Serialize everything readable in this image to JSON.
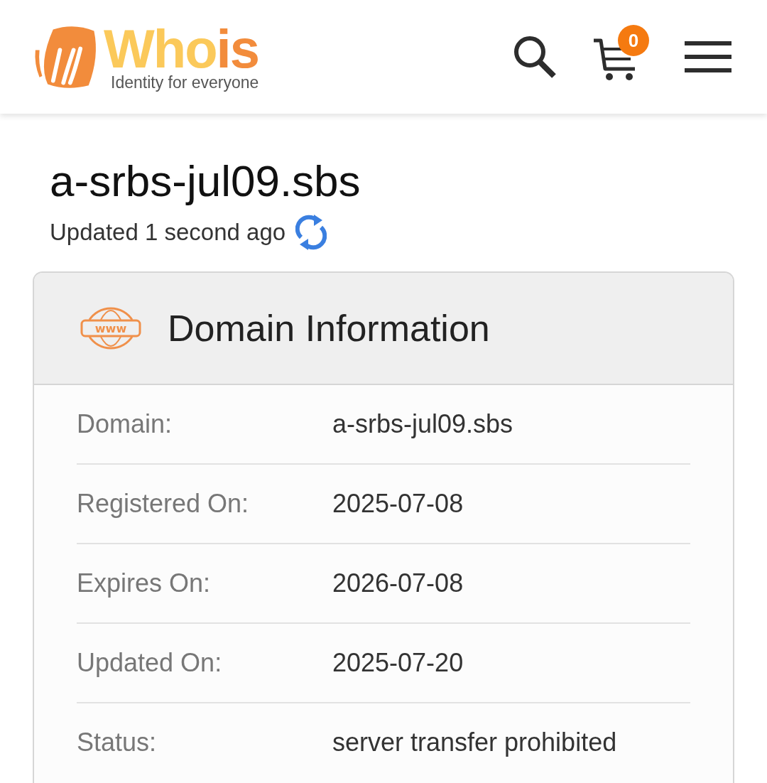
{
  "header": {
    "logo": {
      "word_first": "Who",
      "word_second": "is",
      "tagline": "Identity for everyone"
    },
    "cart_count": "0"
  },
  "domain_title": "a-srbs-jul09.sbs",
  "updated_text": "Updated 1 second ago",
  "card": {
    "title": "Domain Information",
    "icon_text": "www",
    "rows": [
      {
        "label": "Domain:",
        "value": "a-srbs-jul09.sbs"
      },
      {
        "label": "Registered On:",
        "value": "2025-07-08"
      },
      {
        "label": "Expires On:",
        "value": "2026-07-08"
      },
      {
        "label": "Updated On:",
        "value": "2025-07-20"
      },
      {
        "label": "Status:",
        "value": "server transfer prohibited"
      }
    ]
  }
}
